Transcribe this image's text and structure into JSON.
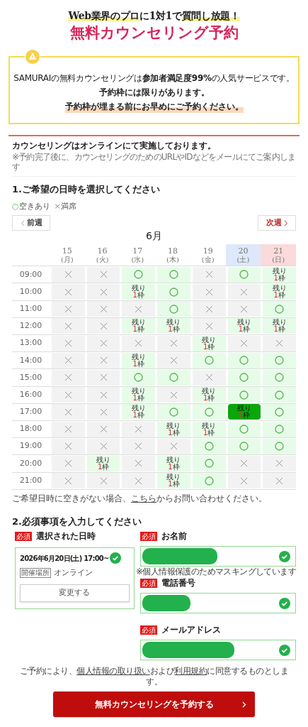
{
  "header": {
    "subtitle_parts": [
      "Web業界のプロ",
      "に1対1で",
      "質問し放題！"
    ],
    "title": "無料カウンセリング予約"
  },
  "notice": {
    "line1": "SAMURAIの無料カウンセリングは**参加者満足度99%**の人気サービスです。",
    "line2": "予約枠には限りがあります。",
    "line3": "予約枠が埋まる前にお早めにご予約ください。"
  },
  "online_note": {
    "title": "カウンセリングはオンラインにて実施しております。",
    "sub": "※予約完了後に、カウンセリングのためのURLやIDなどをメールにてご案内します"
  },
  "step1": {
    "heading": "1.ご希望の日時を選択してください",
    "legend": [
      {
        "kind": "open",
        "symbol": "○",
        "label": "空きあり"
      },
      {
        "kind": "full",
        "symbol": "×",
        "label": "満席"
      }
    ],
    "prev": "前週",
    "next": "次週",
    "month": "6月",
    "days": [
      {
        "date": "15",
        "weekday": "(月)",
        "kind": "weekday"
      },
      {
        "date": "16",
        "weekday": "(火)",
        "kind": "weekday"
      },
      {
        "date": "17",
        "weekday": "(水)",
        "kind": "weekday"
      },
      {
        "date": "18",
        "weekday": "(木)",
        "kind": "weekday"
      },
      {
        "date": "19",
        "weekday": "(金)",
        "kind": "weekday"
      },
      {
        "date": "20",
        "weekday": "(土)",
        "kind": "saturday"
      },
      {
        "date": "21",
        "weekday": "(日)",
        "kind": "sunday"
      }
    ],
    "rows": [
      {
        "time": "09:00",
        "slots": [
          {
            "kind": "full",
            "selected": false
          },
          {
            "kind": "full",
            "selected": false
          },
          {
            "kind": "open",
            "selected": false
          },
          {
            "kind": "open",
            "selected": false
          },
          {
            "kind": "full",
            "selected": false
          },
          {
            "kind": "open",
            "selected": false
          },
          {
            "kind": "few",
            "selected": false,
            "top": "残り",
            "count": "1",
            "unit": "枠"
          }
        ]
      },
      {
        "time": "10:00",
        "slots": [
          {
            "kind": "full",
            "selected": false
          },
          {
            "kind": "full",
            "selected": false
          },
          {
            "kind": "few",
            "selected": false,
            "top": "残り",
            "count": "1",
            "unit": "枠"
          },
          {
            "kind": "open",
            "selected": false
          },
          {
            "kind": "full",
            "selected": false
          },
          {
            "kind": "full",
            "selected": false
          },
          {
            "kind": "few",
            "selected": false,
            "top": "残り",
            "count": "1",
            "unit": "枠"
          }
        ]
      },
      {
        "time": "11:00",
        "slots": [
          {
            "kind": "full",
            "selected": false
          },
          {
            "kind": "full",
            "selected": false
          },
          {
            "kind": "full",
            "selected": false
          },
          {
            "kind": "open",
            "selected": false
          },
          {
            "kind": "full",
            "selected": false
          },
          {
            "kind": "full",
            "selected": false
          },
          {
            "kind": "open",
            "selected": false
          }
        ]
      },
      {
        "time": "12:00",
        "slots": [
          {
            "kind": "full",
            "selected": false
          },
          {
            "kind": "full",
            "selected": false
          },
          {
            "kind": "few",
            "selected": false,
            "top": "残り",
            "count": "1",
            "unit": "枠"
          },
          {
            "kind": "few",
            "selected": false,
            "top": "残り",
            "count": "1",
            "unit": "枠"
          },
          {
            "kind": "full",
            "selected": false
          },
          {
            "kind": "few",
            "selected": false,
            "top": "残り",
            "count": "1",
            "unit": "枠"
          },
          {
            "kind": "few",
            "selected": false,
            "top": "残り",
            "count": "1",
            "unit": "枠"
          }
        ]
      },
      {
        "time": "13:00",
        "slots": [
          {
            "kind": "full",
            "selected": false
          },
          {
            "kind": "full",
            "selected": false
          },
          {
            "kind": "full",
            "selected": false
          },
          {
            "kind": "full",
            "selected": false
          },
          {
            "kind": "few",
            "selected": false,
            "top": "残り",
            "count": "1",
            "unit": "枠"
          },
          {
            "kind": "full",
            "selected": false
          },
          {
            "kind": "full",
            "selected": false
          }
        ]
      },
      {
        "time": "14:00",
        "slots": [
          {
            "kind": "full",
            "selected": false
          },
          {
            "kind": "full",
            "selected": false
          },
          {
            "kind": "few",
            "selected": false,
            "top": "残り",
            "count": "1",
            "unit": "枠"
          },
          {
            "kind": "full",
            "selected": false
          },
          {
            "kind": "open",
            "selected": false
          },
          {
            "kind": "open",
            "selected": false
          },
          {
            "kind": "open",
            "selected": false
          }
        ]
      },
      {
        "time": "15:00",
        "slots": [
          {
            "kind": "full",
            "selected": false
          },
          {
            "kind": "full",
            "selected": false
          },
          {
            "kind": "open",
            "selected": false
          },
          {
            "kind": "open",
            "selected": false
          },
          {
            "kind": "full",
            "selected": false
          },
          {
            "kind": "open",
            "selected": false
          },
          {
            "kind": "open",
            "selected": false
          }
        ]
      },
      {
        "time": "16:00",
        "slots": [
          {
            "kind": "full",
            "selected": false
          },
          {
            "kind": "full",
            "selected": false
          },
          {
            "kind": "few",
            "selected": false,
            "top": "残り",
            "count": "1",
            "unit": "枠"
          },
          {
            "kind": "full",
            "selected": false
          },
          {
            "kind": "few",
            "selected": false,
            "top": "残り",
            "count": "1",
            "unit": "枠"
          },
          {
            "kind": "open",
            "selected": false
          },
          {
            "kind": "open",
            "selected": false
          }
        ]
      },
      {
        "time": "17:00",
        "slots": [
          {
            "kind": "full",
            "selected": false
          },
          {
            "kind": "full",
            "selected": false
          },
          {
            "kind": "few",
            "selected": false,
            "top": "残り",
            "count": "1",
            "unit": "枠"
          },
          {
            "kind": "open",
            "selected": false
          },
          {
            "kind": "open",
            "selected": false
          },
          {
            "kind": "few",
            "selected": true,
            "top": "残り",
            "count": "1",
            "unit": "枠"
          },
          {
            "kind": "open",
            "selected": false
          }
        ]
      },
      {
        "time": "18:00",
        "slots": [
          {
            "kind": "full",
            "selected": false
          },
          {
            "kind": "full",
            "selected": false
          },
          {
            "kind": "full",
            "selected": false
          },
          {
            "kind": "few",
            "selected": false,
            "top": "残り",
            "count": "1",
            "unit": "枠"
          },
          {
            "kind": "few",
            "selected": false,
            "top": "残り",
            "count": "1",
            "unit": "枠"
          },
          {
            "kind": "open",
            "selected": false
          },
          {
            "kind": "open",
            "selected": false
          }
        ]
      },
      {
        "time": "19:00",
        "slots": [
          {
            "kind": "full",
            "selected": false
          },
          {
            "kind": "full",
            "selected": false
          },
          {
            "kind": "full",
            "selected": false
          },
          {
            "kind": "full",
            "selected": false
          },
          {
            "kind": "open",
            "selected": false
          },
          {
            "kind": "open",
            "selected": false
          },
          {
            "kind": "open",
            "selected": false
          }
        ]
      },
      {
        "time": "20:00",
        "slots": [
          {
            "kind": "full",
            "selected": false
          },
          {
            "kind": "few",
            "selected": false,
            "top": "残り",
            "count": "1",
            "unit": "枠"
          },
          {
            "kind": "full",
            "selected": false
          },
          {
            "kind": "few",
            "selected": false,
            "top": "残り",
            "count": "1",
            "unit": "枠"
          },
          {
            "kind": "open",
            "selected": false
          },
          {
            "kind": "full",
            "selected": false
          },
          {
            "kind": "full",
            "selected": false
          }
        ]
      },
      {
        "time": "21:00",
        "slots": [
          {
            "kind": "full",
            "selected": false
          },
          {
            "kind": "full",
            "selected": false
          },
          {
            "kind": "full",
            "selected": false
          },
          {
            "kind": "few",
            "selected": false,
            "top": "残り",
            "count": "1",
            "unit": "枠"
          },
          {
            "kind": "open",
            "selected": false
          },
          {
            "kind": "full",
            "selected": false
          },
          {
            "kind": "full",
            "selected": false
          }
        ]
      }
    ],
    "footer_before": "ご希望日時に空きがない場合、",
    "footer_link": "こちら",
    "footer_after": "からお問い合わせください。"
  },
  "step2": {
    "heading": "2.必須事項を入力してください",
    "datetime": {
      "required_badge": "必須",
      "label": "選択された日時",
      "value": "2026年6月20日(土) 17:00~",
      "valid": true,
      "place_tag": "開催場所",
      "place": "オンライン",
      "change": "変更する"
    },
    "fields": [
      {
        "required_badge": "必須",
        "label": "お名前",
        "masked": true,
        "valid": true,
        "note": "※個人情報保護のためマスキングしています"
      },
      {
        "required_badge": "必須",
        "label": "電話番号",
        "masked": true,
        "valid": true
      },
      {
        "required_badge": "必須",
        "label": "メールアドレス",
        "masked": true,
        "valid": true
      }
    ]
  },
  "consent": {
    "before": "ご予約により、",
    "link1": "個人情報の取り扱い",
    "middle": "および",
    "link2": "利用規約",
    "after": "に同意するものとします。"
  },
  "submit": "無料カウンセリングを予約する"
}
